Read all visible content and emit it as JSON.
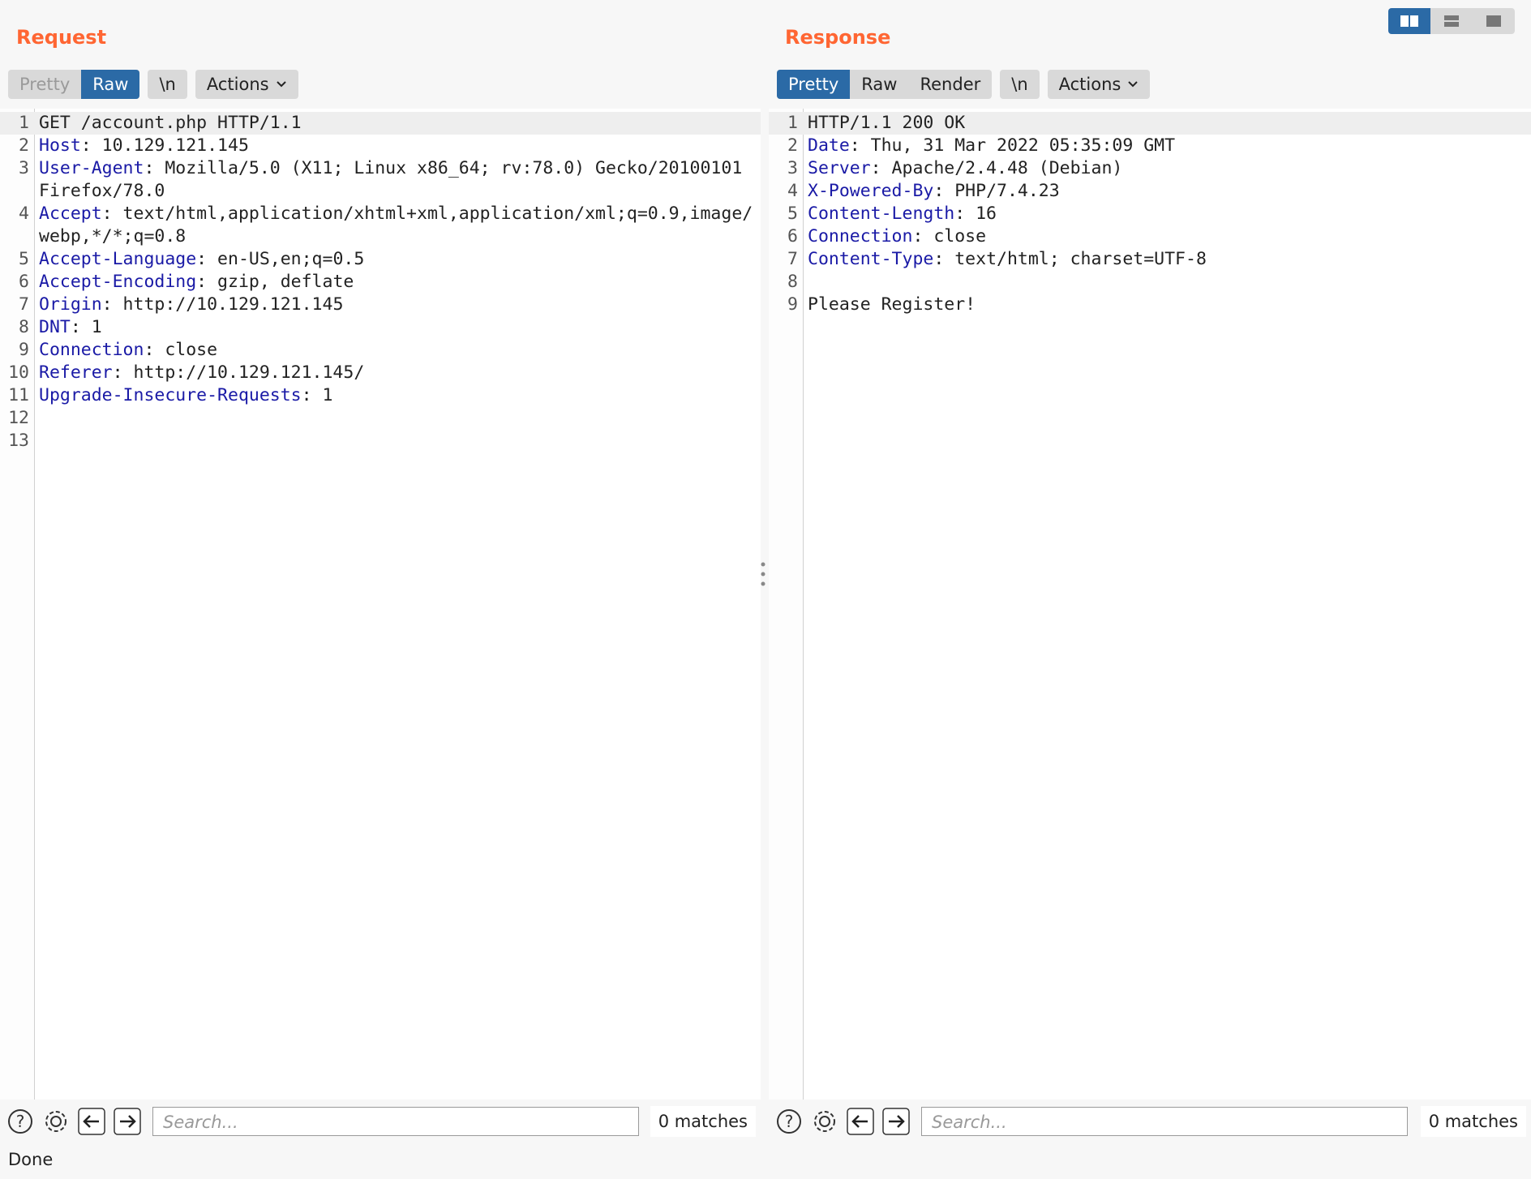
{
  "request": {
    "title": "Request",
    "view_tabs": [
      "Pretty",
      "Raw"
    ],
    "active_tab": "Raw",
    "newline_label": "\\n",
    "actions_label": "Actions",
    "lines": [
      {
        "n": "1",
        "key": "",
        "val": "GET /account.php HTTP/1.1"
      },
      {
        "n": "2",
        "key": "Host",
        "val": ": 10.129.121.145"
      },
      {
        "n": "3",
        "key": "User-Agent",
        "val": ": Mozilla/5.0 (X11; Linux x86_64; rv:78.0) Gecko/20100101 Firefox/78.0"
      },
      {
        "n": "4",
        "key": "Accept",
        "val": ": text/html,application/xhtml+xml,application/xml;q=0.9,image/webp,*/*;q=0.8"
      },
      {
        "n": "5",
        "key": "Accept-Language",
        "val": ": en-US,en;q=0.5"
      },
      {
        "n": "6",
        "key": "Accept-Encoding",
        "val": ": gzip, deflate"
      },
      {
        "n": "7",
        "key": "Origin",
        "val": ": http://10.129.121.145"
      },
      {
        "n": "8",
        "key": "DNT",
        "val": ": 1"
      },
      {
        "n": "9",
        "key": "Connection",
        "val": ": close"
      },
      {
        "n": "10",
        "key": "Referer",
        "val": ": http://10.129.121.145/"
      },
      {
        "n": "11",
        "key": "Upgrade-Insecure-Requests",
        "val": ": 1"
      },
      {
        "n": "12",
        "key": "",
        "val": ""
      },
      {
        "n": "13",
        "key": "",
        "val": ""
      }
    ],
    "search_placeholder": "Search...",
    "matches": "0 matches"
  },
  "response": {
    "title": "Response",
    "view_tabs": [
      "Pretty",
      "Raw",
      "Render"
    ],
    "active_tab": "Pretty",
    "newline_label": "\\n",
    "actions_label": "Actions",
    "lines": [
      {
        "n": "1",
        "key": "",
        "val": "HTTP/1.1 200 OK"
      },
      {
        "n": "2",
        "key": "Date",
        "val": ": Thu, 31 Mar 2022 05:35:09 GMT"
      },
      {
        "n": "3",
        "key": "Server",
        "val": ": Apache/2.4.48 (Debian)"
      },
      {
        "n": "4",
        "key": "X-Powered-By",
        "val": ": PHP/7.4.23"
      },
      {
        "n": "5",
        "key": "Content-Length",
        "val": ": 16"
      },
      {
        "n": "6",
        "key": "Connection",
        "val": ": close"
      },
      {
        "n": "7",
        "key": "Content-Type",
        "val": ": text/html; charset=UTF-8"
      },
      {
        "n": "8",
        "key": "",
        "val": ""
      },
      {
        "n": "9",
        "key": "",
        "val": "Please Register!"
      }
    ],
    "search_placeholder": "Search...",
    "matches": "0 matches"
  },
  "status_text": "Done",
  "colors": {
    "accent_orange": "#ff6633",
    "active_tab_blue": "#2b6aa6",
    "header_key_blue": "#1a1aa6"
  },
  "icons": [
    "help-icon",
    "settings-icon",
    "arrow-left-icon",
    "arrow-right-icon",
    "chevron-down-icon",
    "layout-side-by-side-icon",
    "layout-stacked-icon",
    "layout-single-icon",
    "drag-handle-icon"
  ]
}
